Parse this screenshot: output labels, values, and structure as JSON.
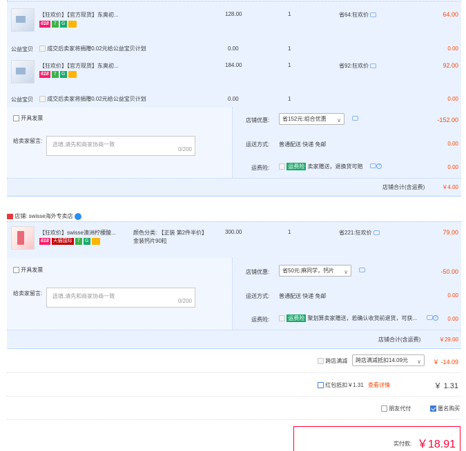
{
  "shop1": {
    "items": [
      {
        "title": "【狂欢价】【官方现货】东奥初...",
        "price": "128.00",
        "qty": "1",
        "saving": "省64:狂欢价",
        "total": "64.00"
      },
      {
        "title": "【狂欢价】【官方现货】东奥初...",
        "price": "184.00",
        "qty": "1",
        "saving": "省92:狂欢价",
        "total": "92.00"
      }
    ],
    "charity": {
      "label": "公益宝贝",
      "text": "成交后卖家将捐赠0.02元给公益宝贝计划",
      "price": "0.00",
      "qty": "1",
      "total": "0.00"
    },
    "invoice_label": "开具发票",
    "message_label": "给卖家留言:",
    "message_placeholder": "选填,请先和商家协商一致",
    "message_count": "0/200",
    "discount_label": "店铺优惠:",
    "discount_value": "省152元:组合优惠",
    "discount_amount": "-152.00",
    "shipping_label": "运送方式:",
    "shipping_value": "普通配送 快递 免邮",
    "shipping_amount": "0.00",
    "insurance_label": "运费险:",
    "insurance_tag": "运费险",
    "insurance_text": "卖家赠送，退换货可赔",
    "insurance_amount": "0.00",
    "total_label": "店铺合计(含运费)",
    "total_value": "￥4.00"
  },
  "shop2": {
    "shop_name": "店铺: swisse海外专卖店",
    "item": {
      "title": "【狂欢价】swisse澳洲柠檬酸...",
      "spec": "颜色分类: 【正装 第2件半价】金装钙片90粒",
      "price": "300.00",
      "qty": "1",
      "saving": "省221:狂欢价",
      "total": "79.00",
      "tmall_badge": "天猫国际"
    },
    "invoice_label": "开具发票",
    "message_label": "给卖家留言:",
    "message_placeholder": "选填,请先和商家协商一致",
    "message_count": "0/200",
    "discount_label": "店铺优惠:",
    "discount_value": "省50元:麻同学，钙片",
    "discount_amount": "-50.00",
    "shipping_label": "运送方式:",
    "shipping_value": "普通配送 快递 免邮",
    "shipping_amount": "0.00",
    "insurance_label": "运费险:",
    "insurance_tag": "运费险",
    "insurance_text": "聚划算卖家赠送，若确认收货前退货，可获...",
    "insurance_amount": "0.00",
    "total_label": "店铺合计(含运费)",
    "total_value": "￥29.00"
  },
  "badge_618": "618",
  "badge_7": "7",
  "badge_g": "G",
  "cross_store": {
    "label": "跨店满减",
    "select": "跨店满减抵扣14.09元",
    "amount": "￥ -14.09"
  },
  "redpacket": {
    "label": "红包抵扣￥1.31",
    "link": "查看详情",
    "amount": "￥ 1.31"
  },
  "friend_pay": "朋友代付",
  "anonymous": "匿名购买",
  "pay": {
    "label": "实付款:",
    "amount": "￥18.91"
  },
  "colors": {
    "accent": "#ff4400",
    "panel": "#eaf2ff",
    "line": "#80b2ff"
  }
}
